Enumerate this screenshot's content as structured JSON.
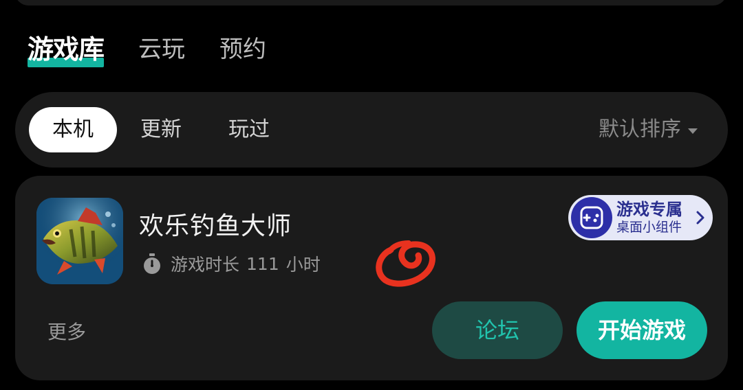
{
  "main_tabs": [
    {
      "label": "游戏库",
      "active": true
    },
    {
      "label": "云玩",
      "active": false
    },
    {
      "label": "预约",
      "active": false
    }
  ],
  "filters": [
    {
      "label": "本机",
      "active": true
    },
    {
      "label": "更新",
      "active": false
    },
    {
      "label": "玩过",
      "active": false
    }
  ],
  "sort_label": "默认排序",
  "game": {
    "title": "欢乐钓鱼大师",
    "playtime_label": "游戏时长",
    "playtime_value": "111",
    "playtime_unit": "小时",
    "widget": {
      "line1": "游戏专属",
      "line2": "桌面小组件"
    },
    "more_label": "更多",
    "forum_label": "论坛",
    "start_label": "开始游戏"
  },
  "colors": {
    "accent": "#13b5a1",
    "background": "#000000",
    "card": "#1b1b1b",
    "scribble": "#e8321f"
  },
  "icons": [
    "stopwatch-icon",
    "gamepad-icon",
    "chevron-right-icon",
    "sort-caret-icon"
  ]
}
